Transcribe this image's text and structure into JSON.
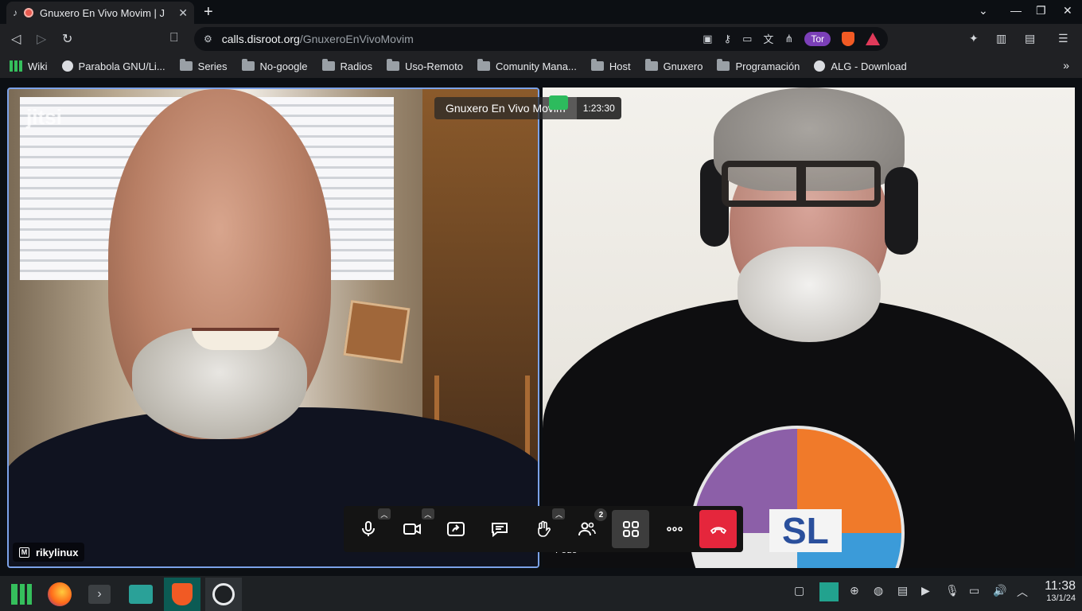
{
  "browser": {
    "tab_title": "Gnuxero En Vivo Movim | J",
    "url_host": "calls.disroot.org",
    "url_path": "/GnuxeroEnVivoMovim",
    "tor_label": "Tor"
  },
  "bookmarks": [
    {
      "label": "Wiki",
      "icon": "wiki-icon"
    },
    {
      "label": "Parabola GNU/Li...",
      "icon": "globe-icon"
    },
    {
      "label": "Series",
      "icon": "folder-icon"
    },
    {
      "label": "No-google",
      "icon": "folder-icon"
    },
    {
      "label": "Radios",
      "icon": "folder-icon"
    },
    {
      "label": "Uso-Remoto",
      "icon": "folder-icon"
    },
    {
      "label": "Comunity Mana...",
      "icon": "folder-icon"
    },
    {
      "label": "Host",
      "icon": "folder-icon"
    },
    {
      "label": "Gnuxero",
      "icon": "folder-icon"
    },
    {
      "label": "Programación",
      "icon": "folder-icon"
    },
    {
      "label": "ALG - Download",
      "icon": "globe-icon"
    }
  ],
  "meeting": {
    "name": "Gnuxero En Vivo Movim",
    "timer": "1:23:30",
    "watermark": "jitsi",
    "participant_count": "2"
  },
  "participants": {
    "left": {
      "name": "rikylinux",
      "badge": "M"
    },
    "right": {
      "name": "Fede"
    }
  },
  "tshirt_text": "SL",
  "taskbar": {
    "time": "11:38",
    "date": "13/1/24"
  }
}
